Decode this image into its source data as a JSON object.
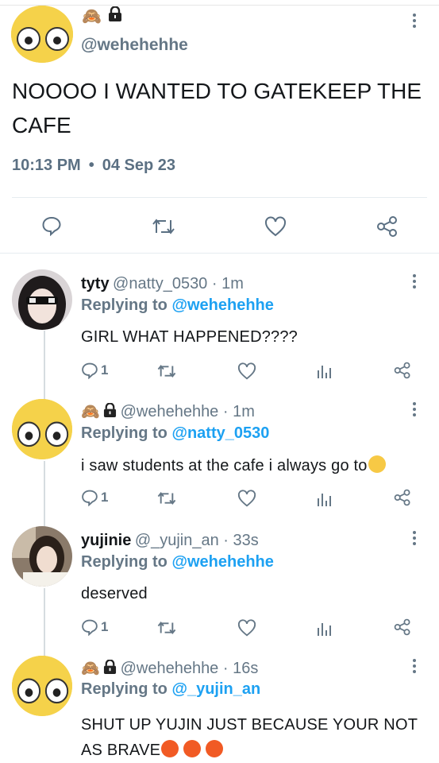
{
  "main_tweet": {
    "handle": "@wehehehhe",
    "avatar_icon": "dizzy-face-emoji",
    "badge_emoji": "🙈",
    "lock_icon": "lock-icon",
    "text": "NOOOO I WANTED TO GATEKEEP THE CAFE",
    "time": "10:13 PM",
    "dot": "•",
    "date": "04 Sep 23",
    "actions": [
      "reply-icon",
      "retweet-icon",
      "like-icon",
      "share-icon"
    ]
  },
  "replies": [
    {
      "name": "tyty",
      "handle": "@natty_0530 · 1m",
      "replying_label": "Replying to",
      "replying_to": "@wehehehhe",
      "text": "GIRL WHAT HAPPENED????",
      "reply_count": "1"
    },
    {
      "badge_emoji": "🙈",
      "handle": "@wehehehhe · 1m",
      "replying_label": "Replying to",
      "replying_to": "@natty_0530",
      "text": "i saw students at the cafe i always go to",
      "reply_count": "1"
    },
    {
      "name": "yujinie",
      "handle": "@_yujin_an · 33s",
      "replying_label": "Replying to",
      "replying_to": "@wehehehhe",
      "text": "deserved",
      "reply_count": "1"
    },
    {
      "badge_emoji": "🙈",
      "handle": "@wehehehhe · 16s",
      "replying_label": "Replying to",
      "replying_to": "@_yujin_an",
      "text": "SHUT UP YUJIN JUST BECAUSE YOUR NOT AS BRAVE"
    }
  ],
  "colors": {
    "link": "#1da1f2",
    "muted": "#657786",
    "text": "#14171a",
    "face": "#f5d24a"
  }
}
